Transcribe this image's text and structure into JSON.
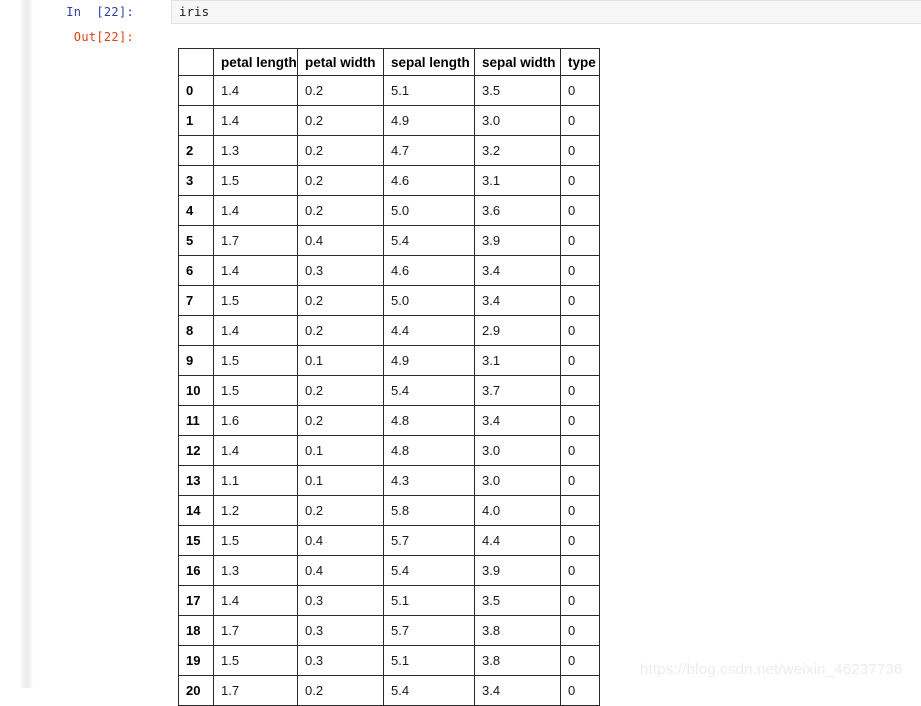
{
  "notebook": {
    "input_prompt": "In  [22]:",
    "output_prompt": "Out[22]:",
    "input_source": "iris"
  },
  "watermark": {
    "text": "https://blog.csdn.net/weixin_46237736"
  },
  "colors": {
    "in_prompt": "#303f9f",
    "out_prompt": "#d84315",
    "input_cell_bg": "#f7f7f7",
    "input_cell_border": "#e3e3e3",
    "table_border": "#2b2b2b",
    "watermark": "#ececec"
  },
  "chart_data": {
    "type": "table",
    "title": "iris",
    "index_header": "",
    "columns": [
      "petal length",
      "petal width",
      "sepal length",
      "sepal width",
      "type"
    ],
    "index": [
      "0",
      "1",
      "2",
      "3",
      "4",
      "5",
      "6",
      "7",
      "8",
      "9",
      "10",
      "11",
      "12",
      "13",
      "14",
      "15",
      "16",
      "17",
      "18",
      "19",
      "20"
    ],
    "rows": [
      [
        "1.4",
        "0.2",
        "5.1",
        "3.5",
        "0"
      ],
      [
        "1.4",
        "0.2",
        "4.9",
        "3.0",
        "0"
      ],
      [
        "1.3",
        "0.2",
        "4.7",
        "3.2",
        "0"
      ],
      [
        "1.5",
        "0.2",
        "4.6",
        "3.1",
        "0"
      ],
      [
        "1.4",
        "0.2",
        "5.0",
        "3.6",
        "0"
      ],
      [
        "1.7",
        "0.4",
        "5.4",
        "3.9",
        "0"
      ],
      [
        "1.4",
        "0.3",
        "4.6",
        "3.4",
        "0"
      ],
      [
        "1.5",
        "0.2",
        "5.0",
        "3.4",
        "0"
      ],
      [
        "1.4",
        "0.2",
        "4.4",
        "2.9",
        "0"
      ],
      [
        "1.5",
        "0.1",
        "4.9",
        "3.1",
        "0"
      ],
      [
        "1.5",
        "0.2",
        "5.4",
        "3.7",
        "0"
      ],
      [
        "1.6",
        "0.2",
        "4.8",
        "3.4",
        "0"
      ],
      [
        "1.4",
        "0.1",
        "4.8",
        "3.0",
        "0"
      ],
      [
        "1.1",
        "0.1",
        "4.3",
        "3.0",
        "0"
      ],
      [
        "1.2",
        "0.2",
        "5.8",
        "4.0",
        "0"
      ],
      [
        "1.5",
        "0.4",
        "5.7",
        "4.4",
        "0"
      ],
      [
        "1.3",
        "0.4",
        "5.4",
        "3.9",
        "0"
      ],
      [
        "1.4",
        "0.3",
        "5.1",
        "3.5",
        "0"
      ],
      [
        "1.7",
        "0.3",
        "5.7",
        "3.8",
        "0"
      ],
      [
        "1.5",
        "0.3",
        "5.1",
        "3.8",
        "0"
      ],
      [
        "1.7",
        "0.2",
        "5.4",
        "3.4",
        "0"
      ]
    ]
  }
}
